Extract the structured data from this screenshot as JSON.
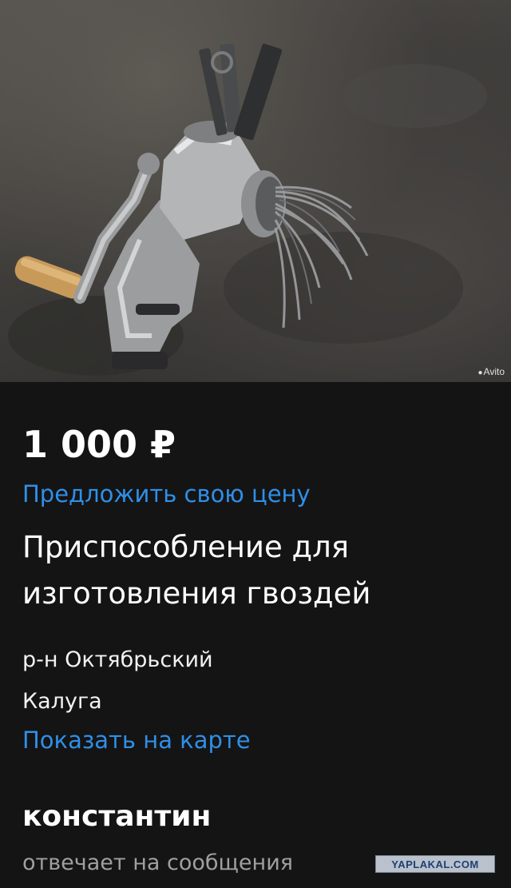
{
  "listing": {
    "photo_watermark": "Avito",
    "price": "1 000 ₽",
    "offer_price_link": "Предложить свою цену",
    "title": "Приспособление для изготовления гвоздей",
    "district": "р-н Октябрьский",
    "city": "Калуга",
    "show_on_map_link": "Показать на карте"
  },
  "seller": {
    "name": "константин",
    "status": "отвечает на сообщения"
  },
  "watermark_badge": "YAPLAKAL.COM",
  "colors": {
    "background": "#141414",
    "link": "#2f8fe8",
    "secondary_text": "#a0a0a0"
  }
}
